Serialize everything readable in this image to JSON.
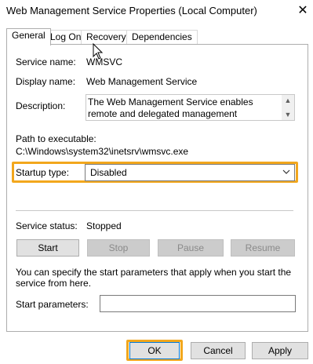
{
  "window": {
    "title": "Web Management Service Properties (Local Computer)"
  },
  "tabs": [
    {
      "label": "General",
      "active": true
    },
    {
      "label": "Log On",
      "active": false
    },
    {
      "label": "Recovery",
      "active": false
    },
    {
      "label": "Dependencies",
      "active": false
    }
  ],
  "general": {
    "service_name_label": "Service name:",
    "service_name_value": "WMSVC",
    "display_name_label": "Display name:",
    "display_name_value": "Web Management Service",
    "description_label": "Description:",
    "description_value": "The Web Management Service enables remote and delegated management capabilities for administrators",
    "path_label": "Path to executable:",
    "path_value": "C:\\Windows\\system32\\inetsrv\\wmsvc.exe",
    "startup_type_label": "Startup type:",
    "startup_type_value": "Disabled",
    "service_status_label": "Service status:",
    "service_status_value": "Stopped",
    "buttons": {
      "start": "Start",
      "stop": "Stop",
      "pause": "Pause",
      "resume": "Resume"
    },
    "info_text": "You can specify the start parameters that apply when you start the service from here.",
    "start_params_label": "Start parameters:",
    "start_params_value": ""
  },
  "footer": {
    "ok": "OK",
    "cancel": "Cancel",
    "apply": "Apply"
  },
  "colors": {
    "highlight": "#f2a71d",
    "focus": "#0078d7"
  }
}
